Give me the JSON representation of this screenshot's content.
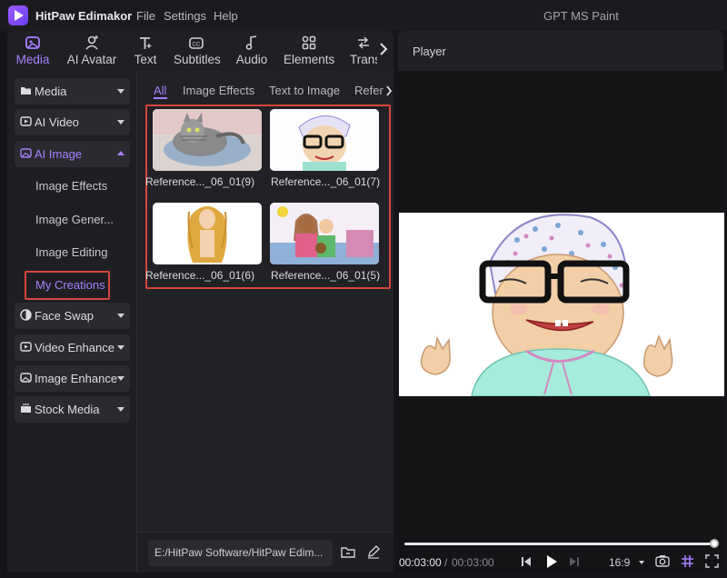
{
  "app": {
    "name": "HitPaw Edimakor",
    "menu": [
      "File",
      "Settings",
      "Help"
    ],
    "document_title": "GPT MS Paint"
  },
  "toolbar": {
    "tabs": [
      {
        "label": "Media",
        "icon": "media-icon"
      },
      {
        "label": "AI Avatar",
        "icon": "avatar-icon"
      },
      {
        "label": "Text",
        "icon": "text-icon"
      },
      {
        "label": "Subtitles",
        "icon": "subtitles-icon"
      },
      {
        "label": "Audio",
        "icon": "audio-icon"
      },
      {
        "label": "Elements",
        "icon": "elements-icon"
      },
      {
        "label": "Trans",
        "icon": "transition-icon"
      }
    ],
    "active_tab": "Media"
  },
  "sidebar": {
    "categories": [
      {
        "label": "Media"
      },
      {
        "label": "AI Video"
      },
      {
        "label": "AI Image",
        "expanded": true,
        "children": [
          "Image Effects",
          "Image Gener...",
          "Image Editing",
          "My Creations"
        ]
      },
      {
        "label": "Face Swap"
      },
      {
        "label": "Video Enhance"
      },
      {
        "label": "Image Enhance"
      },
      {
        "label": "Stock Media"
      }
    ],
    "selected_child": "My Creations"
  },
  "content_tabs": [
    "All",
    "Image Effects",
    "Text to Image",
    "Refere"
  ],
  "active_content_tab": "All",
  "creations": [
    {
      "label": "Reference..._06_01(9)"
    },
    {
      "label": "Reference..._06_01(7)"
    },
    {
      "label": "Reference..._06_01(6)"
    },
    {
      "label": "Reference..._06_01(5)"
    }
  ],
  "save_path": "E:/HitPaw Software/HitPaw Edim...",
  "player": {
    "title": "Player",
    "current_time": "00:03:00",
    "separator": "/",
    "total_time": "00:03:00",
    "aspect_ratio": "16:9",
    "progress": 1.0
  },
  "colors": {
    "accent": "#a780ff",
    "highlight_box": "#d6473a",
    "background": "#16161a"
  }
}
